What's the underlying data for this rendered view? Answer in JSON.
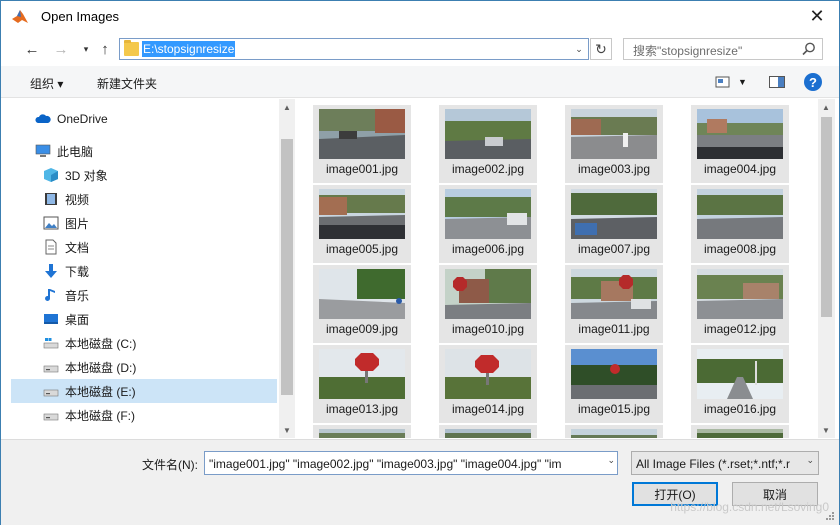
{
  "window": {
    "title": "Open Images",
    "close_label": "✕"
  },
  "address": {
    "path": "E:\\stopsignresize"
  },
  "search": {
    "placeholder": "搜索\"stopsignresize\""
  },
  "toolbar": {
    "organize": "组织 ▾",
    "new_folder": "新建文件夹",
    "help": "?"
  },
  "sidebar": {
    "items": [
      {
        "label": "OneDrive",
        "icon": "cloud-icon"
      },
      {
        "label": "此电脑",
        "icon": "computer-icon"
      },
      {
        "label": "3D 对象",
        "icon": "cube-icon"
      },
      {
        "label": "视频",
        "icon": "video-icon"
      },
      {
        "label": "图片",
        "icon": "picture-icon"
      },
      {
        "label": "文档",
        "icon": "document-icon"
      },
      {
        "label": "下载",
        "icon": "download-icon"
      },
      {
        "label": "音乐",
        "icon": "music-icon"
      },
      {
        "label": "桌面",
        "icon": "desktop-icon"
      },
      {
        "label": "本地磁盘 (C:)",
        "icon": "drive-icon"
      },
      {
        "label": "本地磁盘 (D:)",
        "icon": "drive-icon"
      },
      {
        "label": "本地磁盘 (E:)",
        "icon": "drive-icon",
        "selected": true
      },
      {
        "label": "本地磁盘 (F:)",
        "icon": "drive-icon"
      }
    ]
  },
  "files": [
    "image001.jpg",
    "image002.jpg",
    "image003.jpg",
    "image004.jpg",
    "image005.jpg",
    "image006.jpg",
    "image007.jpg",
    "image008.jpg",
    "image009.jpg",
    "image010.jpg",
    "image011.jpg",
    "image012.jpg",
    "image013.jpg",
    "image014.jpg",
    "image015.jpg",
    "image016.jpg"
  ],
  "bottom": {
    "filename_label": "文件名(N):",
    "filename_value": "\"image001.jpg\" \"image002.jpg\" \"image003.jpg\" \"image004.jpg\" \"im",
    "filter_value": "All Image Files (*.rset;*.ntf;*.r",
    "open_label": "打开(O)",
    "cancel_label": "取消",
    "watermark": "https://blog.csdn.net/Lsoving0"
  },
  "colors": {
    "accent": "#0078d7",
    "selection": "#cce4f7",
    "address_highlight": "#3399ff"
  }
}
